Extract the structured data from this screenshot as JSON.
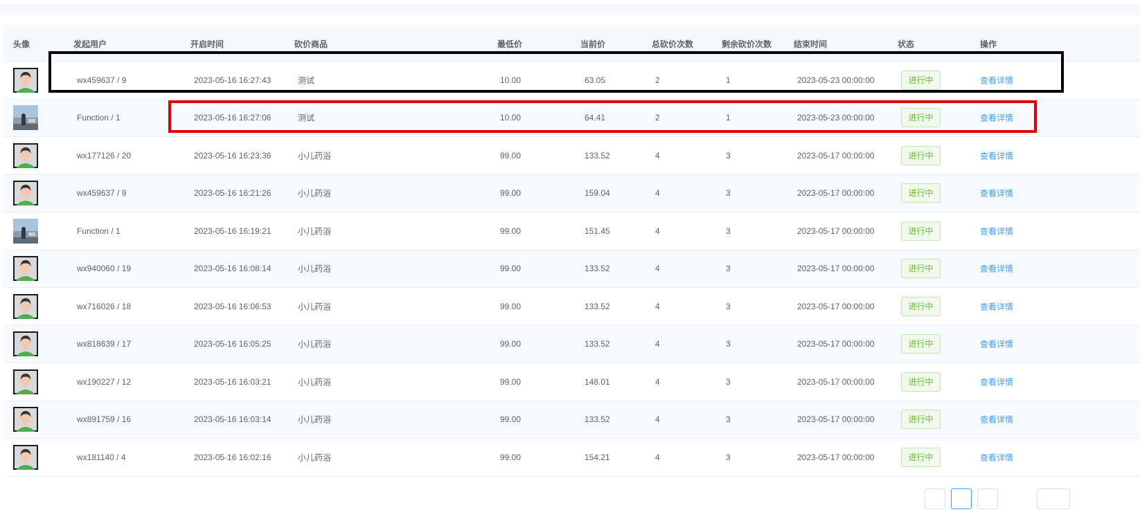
{
  "columns": {
    "avatar": "头像",
    "user": "发起用户",
    "start_time": "开启时间",
    "product": "砍价商品",
    "min_price": "最低价",
    "current_price": "当前价",
    "total_cuts": "总砍价次数",
    "remaining_cuts": "剩余砍价次数",
    "end_time": "结束时间",
    "status": "状态",
    "action": "操作"
  },
  "rows": [
    {
      "avatar": "default",
      "user": "wx459637 / 9",
      "start_time": "2023-05-16 16:27:43",
      "product": "测试",
      "min_price": "10.00",
      "current_price": "63.05",
      "total_cuts": "2",
      "remaining_cuts": "1",
      "end_time": "2023-05-23 00:00:00",
      "status": "进行中",
      "action": "查看详情"
    },
    {
      "avatar": "photo",
      "user": "Function / 1",
      "start_time": "2023-05-16 16:27:06",
      "product": "测试",
      "min_price": "10.00",
      "current_price": "64.41",
      "total_cuts": "2",
      "remaining_cuts": "1",
      "end_time": "2023-05-23 00:00:00",
      "status": "进行中",
      "action": "查看详情"
    },
    {
      "avatar": "default",
      "user": "wx177126 / 20",
      "start_time": "2023-05-16 16:23:36",
      "product": "小儿药浴",
      "min_price": "99.00",
      "current_price": "133.52",
      "total_cuts": "4",
      "remaining_cuts": "3",
      "end_time": "2023-05-17 00:00:00",
      "status": "进行中",
      "action": "查看详情"
    },
    {
      "avatar": "default",
      "user": "wx459637 / 9",
      "start_time": "2023-05-16 16:21:26",
      "product": "小儿药浴",
      "min_price": "99.00",
      "current_price": "159.04",
      "total_cuts": "4",
      "remaining_cuts": "3",
      "end_time": "2023-05-17 00:00:00",
      "status": "进行中",
      "action": "查看详情"
    },
    {
      "avatar": "photo",
      "user": "Function / 1",
      "start_time": "2023-05-16 16:19:21",
      "product": "小儿药浴",
      "min_price": "99.00",
      "current_price": "151.45",
      "total_cuts": "4",
      "remaining_cuts": "3",
      "end_time": "2023-05-17 00:00:00",
      "status": "进行中",
      "action": "查看详情"
    },
    {
      "avatar": "default",
      "user": "wx940060 / 19",
      "start_time": "2023-05-16 16:08:14",
      "product": "小儿药浴",
      "min_price": "99.00",
      "current_price": "133.52",
      "total_cuts": "4",
      "remaining_cuts": "3",
      "end_time": "2023-05-17 00:00:00",
      "status": "进行中",
      "action": "查看详情"
    },
    {
      "avatar": "default",
      "user": "wx716026 / 18",
      "start_time": "2023-05-16 16:06:53",
      "product": "小儿药浴",
      "min_price": "99.00",
      "current_price": "133.52",
      "total_cuts": "4",
      "remaining_cuts": "3",
      "end_time": "2023-05-17 00:00:00",
      "status": "进行中",
      "action": "查看详情"
    },
    {
      "avatar": "default",
      "user": "wx818639 / 17",
      "start_time": "2023-05-16 16:05:25",
      "product": "小儿药浴",
      "min_price": "99.00",
      "current_price": "133.52",
      "total_cuts": "4",
      "remaining_cuts": "3",
      "end_time": "2023-05-17 00:00:00",
      "status": "进行中",
      "action": "查看详情"
    },
    {
      "avatar": "default",
      "user": "wx190227 / 12",
      "start_time": "2023-05-16 16:03:21",
      "product": "小儿药浴",
      "min_price": "99.00",
      "current_price": "148.01",
      "total_cuts": "4",
      "remaining_cuts": "3",
      "end_time": "2023-05-17 00:00:00",
      "status": "进行中",
      "action": "查看详情"
    },
    {
      "avatar": "default",
      "user": "wx891759 / 16",
      "start_time": "2023-05-16 16:03:14",
      "product": "小儿药浴",
      "min_price": "99.00",
      "current_price": "133.52",
      "total_cuts": "4",
      "remaining_cuts": "3",
      "end_time": "2023-05-17 00:00:00",
      "status": "进行中",
      "action": "查看详情"
    },
    {
      "avatar": "default",
      "user": "wx181140 / 4",
      "start_time": "2023-05-16 16:02:16",
      "product": "小儿药浴",
      "min_price": "99.00",
      "current_price": "154.21",
      "total_cuts": "4",
      "remaining_cuts": "3",
      "end_time": "2023-05-17 00:00:00",
      "status": "进行中",
      "action": "查看详情"
    }
  ],
  "colors": {
    "status_text": "#67c23a",
    "status_border": "#c2e7b0",
    "link": "#409eff",
    "highlight_black": "#000000",
    "highlight_red": "#e00000"
  }
}
